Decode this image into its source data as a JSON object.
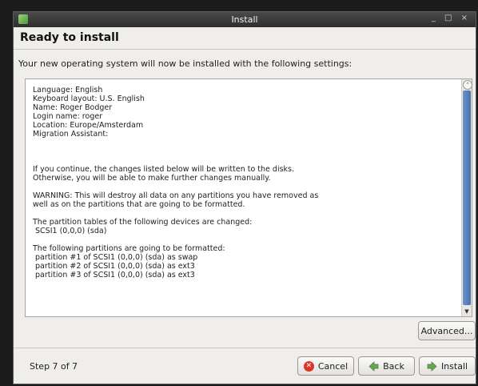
{
  "window": {
    "title": "Install",
    "controls": "_ □ ×"
  },
  "header": {
    "title": "Ready to install"
  },
  "intro": "Your new operating system will now be installed with the following settings:",
  "summary_lines": [
    "Language: English",
    "Keyboard layout: U.S. English",
    "Name: Roger Bodger",
    "Login name: roger",
    "Location: Europe/Amsterdam",
    "Migration Assistant:",
    "",
    "",
    "",
    "If you continue, the changes listed below will be written to the disks.",
    "Otherwise, you will be able to make further changes manually.",
    "",
    "WARNING: This will destroy all data on any partitions you have removed as",
    "well as on the partitions that are going to be formatted.",
    "",
    "The partition tables of the following devices are changed:",
    " SCSI1 (0,0,0) (sda)",
    "",
    "The following partitions are going to be formatted:",
    " partition #1 of SCSI1 (0,0,0) (sda) as swap",
    " partition #2 of SCSI1 (0,0,0) (sda) as ext3",
    " partition #3 of SCSI1 (0,0,0) (sda) as ext3"
  ],
  "buttons": {
    "advanced": "Advanced...",
    "cancel": "Cancel",
    "back": "Back",
    "install": "Install"
  },
  "step_text": "Step 7 of 7",
  "icons": {
    "app": "installer-icon",
    "cancel": "cancel-icon",
    "back": "back-arrow-icon",
    "install": "forward-arrow-icon"
  },
  "colors": {
    "cancel_icon": "#d9362b",
    "arrow_icon": "#6aa84f",
    "scroll_thumb": "#4f76b4"
  }
}
